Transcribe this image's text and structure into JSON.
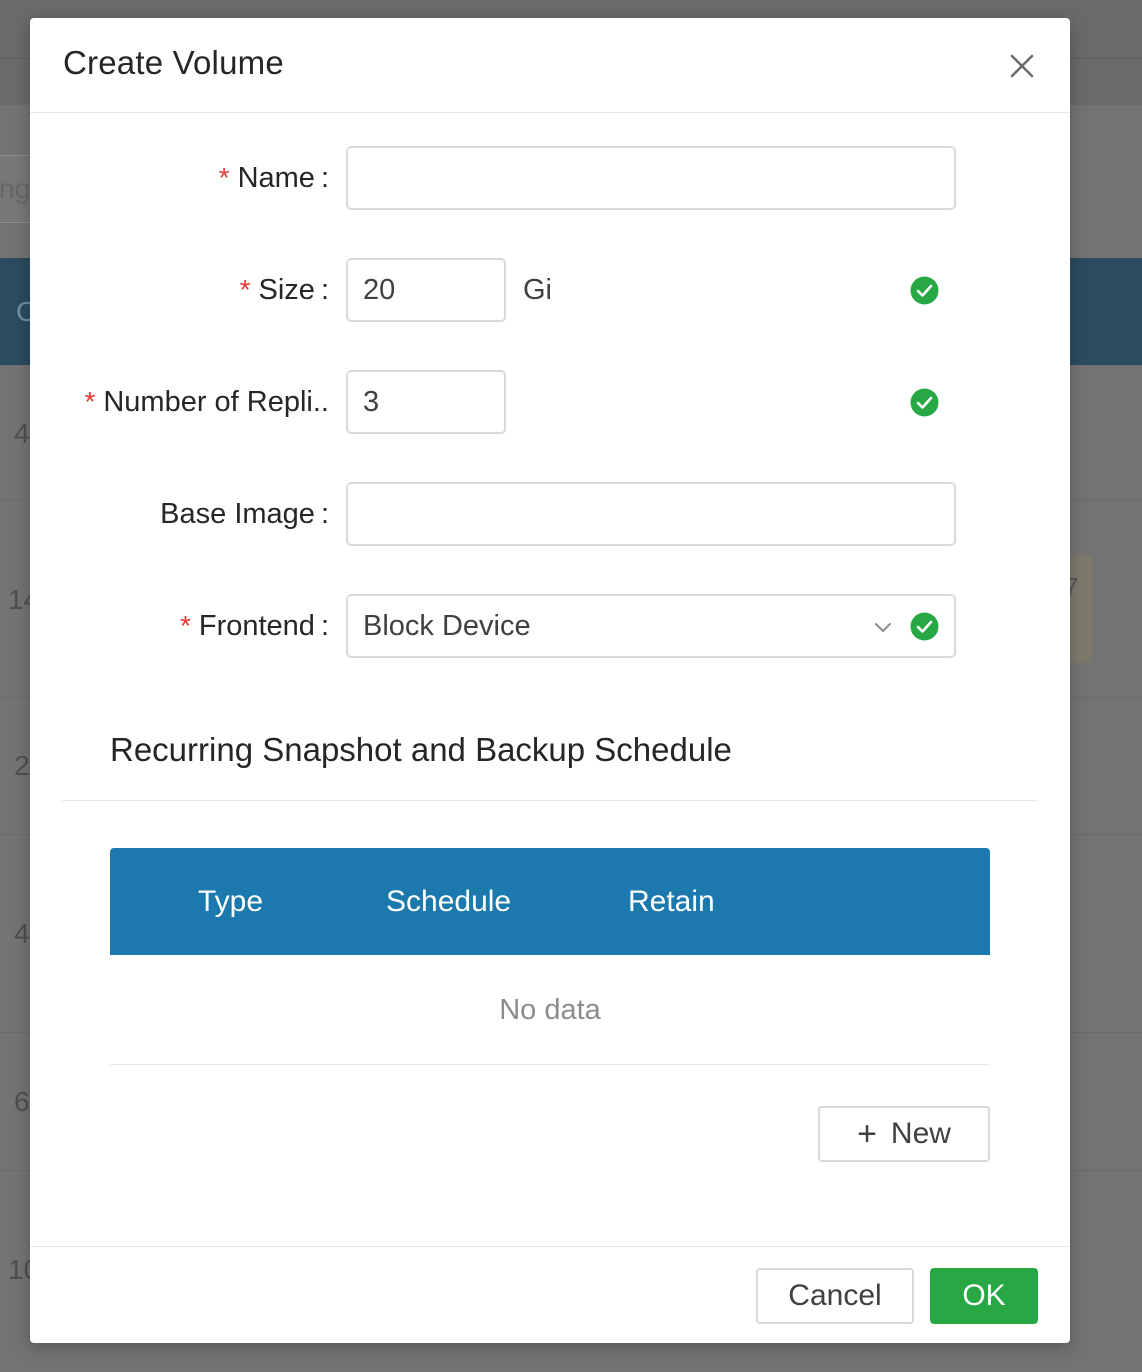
{
  "background": {
    "search_fragment": "ng",
    "table_header_fragment": "C",
    "row_fragments": [
      "4",
      "14",
      "2",
      "4",
      "6",
      "10"
    ],
    "right_fragment": "7"
  },
  "dialog": {
    "title": "Create Volume",
    "close_icon": "close-icon"
  },
  "form": {
    "required_mark": "*",
    "colon": ":",
    "name": {
      "label": "Name",
      "value": ""
    },
    "size": {
      "label": "Size",
      "value": "20",
      "unit": "Gi",
      "status": "success"
    },
    "replicas": {
      "label": "Number of Repli..",
      "value": "3",
      "status": "success"
    },
    "base_image": {
      "label": "Base Image",
      "value": ""
    },
    "frontend": {
      "label": "Frontend",
      "value": "Block Device",
      "status": "success"
    }
  },
  "schedule": {
    "title": "Recurring Snapshot and Backup Schedule",
    "columns": [
      "Type",
      "Schedule",
      "Retain"
    ],
    "empty_text": "No data",
    "new_button": "New"
  },
  "footer": {
    "cancel": "Cancel",
    "ok": "OK"
  },
  "colors": {
    "primary": "#1b79ad",
    "success": "#27a844",
    "required": "#e53935"
  }
}
